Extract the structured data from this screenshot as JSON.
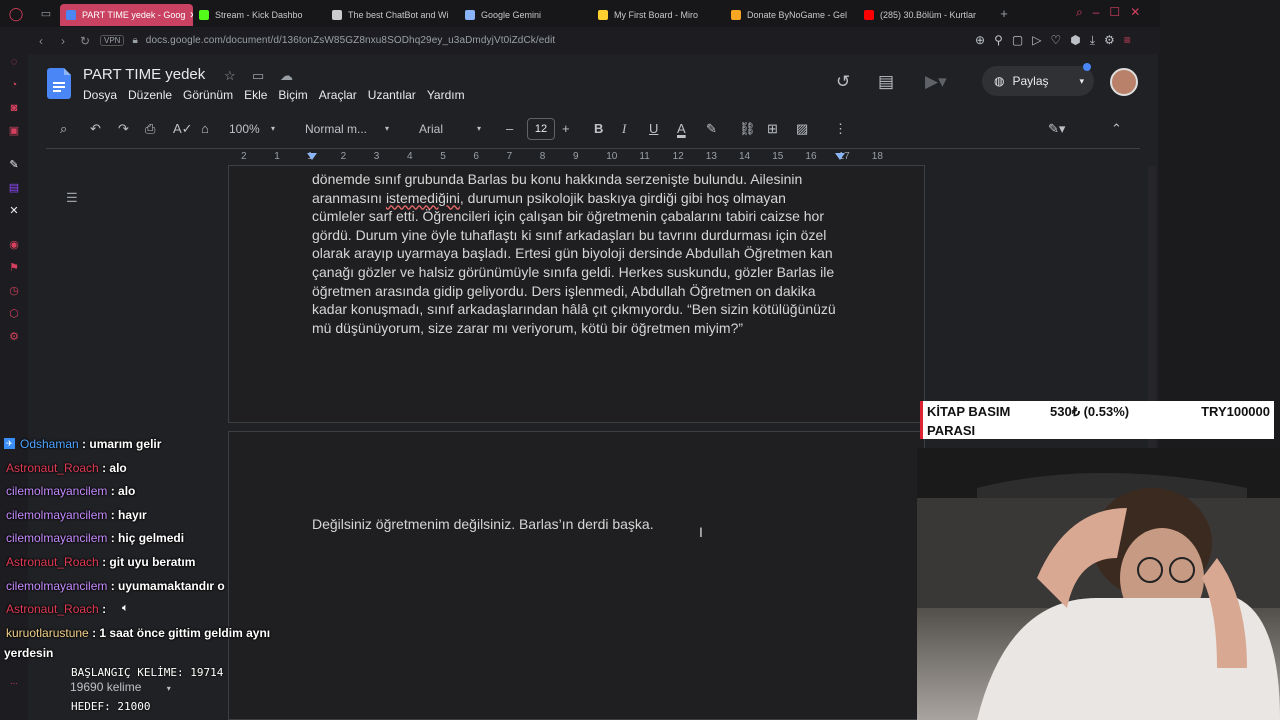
{
  "browser": {
    "tabs": [
      {
        "label": "PART TIME yedek - Goog",
        "active": true,
        "color": "#4a86f5"
      },
      {
        "label": "Stream - Kick Dashbo",
        "active": false,
        "color": "#53fc18"
      },
      {
        "label": "The best ChatBot and Wi",
        "active": false,
        "color": "#cccccc"
      },
      {
        "label": "Google Gemini",
        "active": false,
        "color": "#8ab4f8"
      },
      {
        "label": "My First Board - Miro",
        "active": false,
        "color": "#ffd02f"
      },
      {
        "label": "Donate ByNoGame - Gel",
        "active": false,
        "color": "#f6a623"
      },
      {
        "label": "(285) 30.Bölüm - Kurtlar",
        "active": false,
        "color": "#ff0000"
      }
    ],
    "url": "docs.google.com/document/d/136tonZsW85GZ8nxu8SODhq29ey_u3aDmdyjVt0iZdCk/edit",
    "vpn_label": "VPN"
  },
  "doc": {
    "title": "PART TIME  yedek",
    "menus": [
      "Dosya",
      "Düzenle",
      "Görünüm",
      "Ekle",
      "Biçim",
      "Araçlar",
      "Uzantılar",
      "Yardım"
    ],
    "share_label": "Paylaş",
    "toolbar": {
      "zoom": "100%",
      "style": "Normal m...",
      "font": "Arial",
      "size": "12"
    },
    "ruler": [
      "2",
      "1",
      "1",
      "2",
      "3",
      "4",
      "5",
      "6",
      "7",
      "8",
      "9",
      "10",
      "11",
      "12",
      "13",
      "14",
      "15",
      "16",
      "17",
      "18"
    ],
    "paragraph_lines": [
      "dönemde sınıf grubunda Barlas bu konu hakkında serzenişte bulundu. Ailesinin",
      "cümleler sarf etti. Öğrencileri için çalışan bir öğretmenin çabalarını tabiri caizse hor",
      "gördü. Durum yine öyle tuhaflaştı ki sınıf arkadaşları bu tavrını durdurması için özel",
      "olarak arayıp uyarmaya başladı. Ertesi gün biyoloji dersinde Abdullah Öğretmen kan",
      "çanağı gözler ve halsiz görünümüyle sınıfa geldi. Herkes suskundu, gözler Barlas ile",
      "öğretmen arasında gidip geliyordu. Ders işlenmedi, Abdullah Öğretmen on dakika",
      "kadar konuşmadı, sınıf arkadaşlarından hâlâ çıt çıkmıyordu. “Ben sizin kötülüğünüzü",
      "mü düşünüyorum, size zarar mı veriyorum, kötü bir öğretmen miyim?”"
    ],
    "line2_start": "aranmasını",
    "line2_misspelled": "istemediğini",
    "line2_end": ", durumun psikolojik baskıya girdiği gibi hoş olmayan",
    "page2_text": "Değilsiniz öğretmenim değilsiniz. Barlas’ın derdi başka."
  },
  "chat": [
    {
      "user": "Odshaman",
      "text": ": umarım gelir",
      "color": "blue"
    },
    {
      "user": "Astronaut_Roach",
      "text": ": alo",
      "color": "red"
    },
    {
      "user": "cilemolmayancilem",
      "text": ": alo",
      "color": "purple"
    },
    {
      "user": "cilemolmayancilem",
      "text": ": hayır",
      "color": "purple"
    },
    {
      "user": "cilemolmayancilem",
      "text": ": hiç gelmedi",
      "color": "purple"
    },
    {
      "user": "Astronaut_Roach",
      "text": ": git uyu beratım",
      "color": "red"
    },
    {
      "user": "cilemolmayancilem",
      "text": ": uyumamaktandır o",
      "color": "purple"
    },
    {
      "user": "Astronaut_Roach",
      "text": ":",
      "color": "red"
    },
    {
      "user": "kuruotlarustune",
      "text": ": 1 saat önce gittim geldim aynı",
      "color": "yellow"
    }
  ],
  "chat_wrap": "yerdesin",
  "overlay": {
    "start_words": "BAŞLANGIÇ KELİME: 19714",
    "word_count": "19690 kelime",
    "target": "HEDEF: 21000"
  },
  "ticker": {
    "name_line1": "KİTAP BASIM",
    "name_line2": "PARASI",
    "change": "530₺ (0.53%)",
    "total": "TRY100000"
  }
}
